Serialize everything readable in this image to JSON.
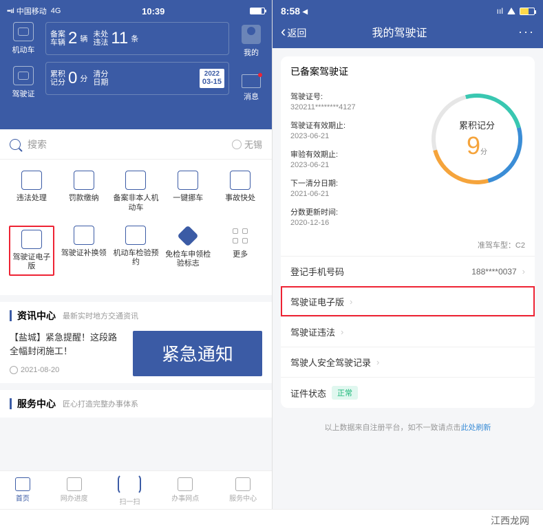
{
  "left": {
    "status": {
      "carrier": "中国移动",
      "network": "4G",
      "time": "10:39"
    },
    "nav": {
      "vehicle": "机动车",
      "license": "驾驶证",
      "mine": "我的",
      "message": "消息"
    },
    "card1": {
      "seg1a": "备案",
      "seg1b": "车辆",
      "val1": "2",
      "unit1": "辆",
      "seg2a": "未处",
      "seg2b": "违法",
      "val2": "11",
      "unit2": "条"
    },
    "card2": {
      "seg1a": "累积",
      "seg1b": "记分",
      "val1": "0",
      "unit1": "分",
      "seg2a": "清分",
      "seg2b": "日期",
      "year": "2022",
      "date": "03-15"
    },
    "search": {
      "placeholder": "搜索",
      "city_label": "无锡"
    },
    "tiles_row1": [
      {
        "label": "违法处理"
      },
      {
        "label": "罚款缴纳"
      },
      {
        "label": "备案非本人机动车"
      },
      {
        "label": "一键挪车"
      },
      {
        "label": "事故快处"
      }
    ],
    "tiles_row2": [
      {
        "label": "驾驶证电子版"
      },
      {
        "label": "驾驶证补换领"
      },
      {
        "label": "机动车检验预约"
      },
      {
        "label": "免检车申领检验标志"
      },
      {
        "label": "更多"
      }
    ],
    "news": {
      "title": "资讯中心",
      "sub": "最新实时地方交通资讯",
      "item": "【盐城】紧急提醒！这段路全幅封闭施工！",
      "date": "2021-08-20",
      "banner": "紧急通知"
    },
    "service": {
      "title": "服务中心",
      "sub": "匠心打造完整办事体系"
    },
    "tabs": [
      {
        "label": "首页"
      },
      {
        "label": "网办进度"
      },
      {
        "label": "扫一扫"
      },
      {
        "label": "办事网点"
      },
      {
        "label": "服务中心"
      }
    ]
  },
  "right": {
    "status": {
      "time": "8:58"
    },
    "nav": {
      "back": "返回",
      "title": "我的驾驶证"
    },
    "card": {
      "heading": "已备案驾驶证",
      "pairs": [
        {
          "lbl": "驾驶证号:",
          "val": "320211********4127"
        },
        {
          "lbl": "驾驶证有效期止:",
          "val": "2023-06-21"
        },
        {
          "lbl": "审验有效期止:",
          "val": "2023-06-21"
        },
        {
          "lbl": "下一清分日期:",
          "val": "2021-06-21"
        },
        {
          "lbl": "分数更新时间:",
          "val": "2020-12-16"
        }
      ],
      "dial": {
        "label": "累积记分",
        "value": "9",
        "unit": "分",
        "foot": "准驾车型：C2"
      },
      "cells": [
        {
          "label": "登记手机号码",
          "value": "188****0037"
        },
        {
          "label": "驾驶证电子版",
          "hl": true
        },
        {
          "label": "驾驶证违法"
        },
        {
          "label": "驾驶人安全驾驶记录"
        },
        {
          "label": "证件状态",
          "status": "正常"
        }
      ],
      "footer_pre": "以上数据来自注册平台，如不一致请点击",
      "footer_link": "此处刷新"
    }
  },
  "watermark": "江西龙网"
}
